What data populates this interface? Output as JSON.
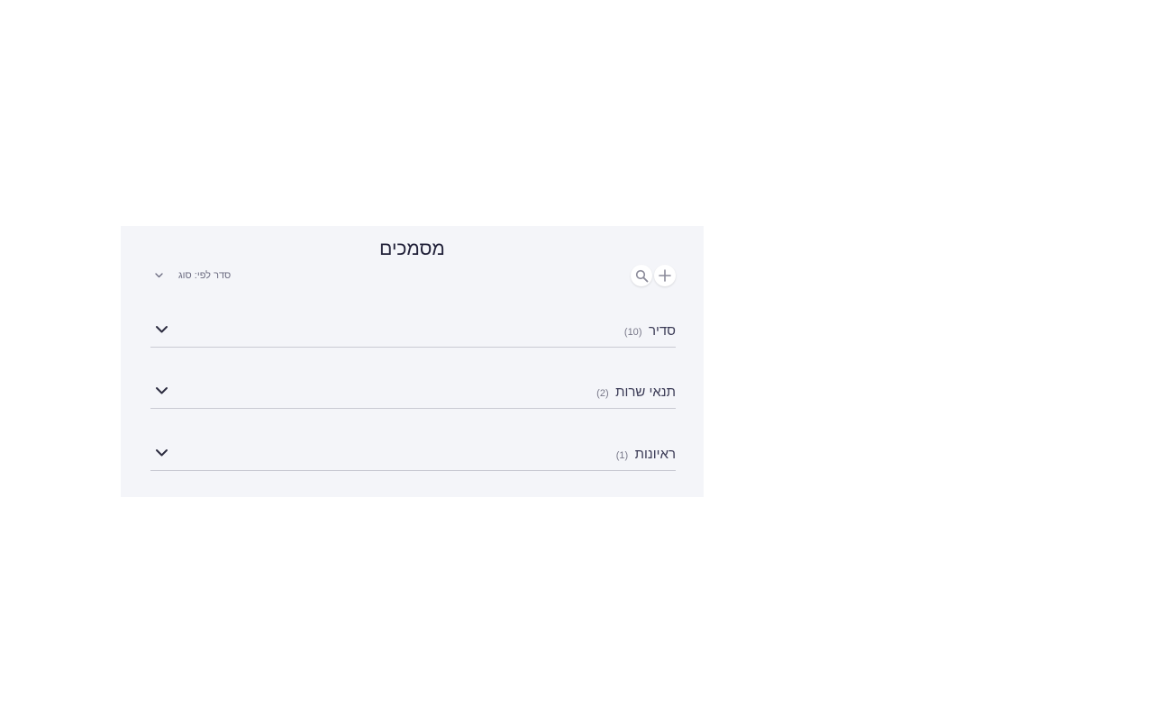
{
  "header": {
    "title": "מסמכים"
  },
  "toolbar": {
    "add_icon": "plus-icon",
    "search_icon": "search-icon",
    "sort_label": "סדר לפי: סוג",
    "sort_icon": "chevron-down-icon"
  },
  "sections": [
    {
      "name": "סדיר",
      "count": "(10)"
    },
    {
      "name": "תנאי שרות",
      "count": "(2)"
    },
    {
      "name": "ראיונות",
      "count": "(1)"
    }
  ],
  "colors": {
    "panel_bg": "#f4f5f9",
    "title": "#22223a",
    "divider": "#c9cad3"
  }
}
